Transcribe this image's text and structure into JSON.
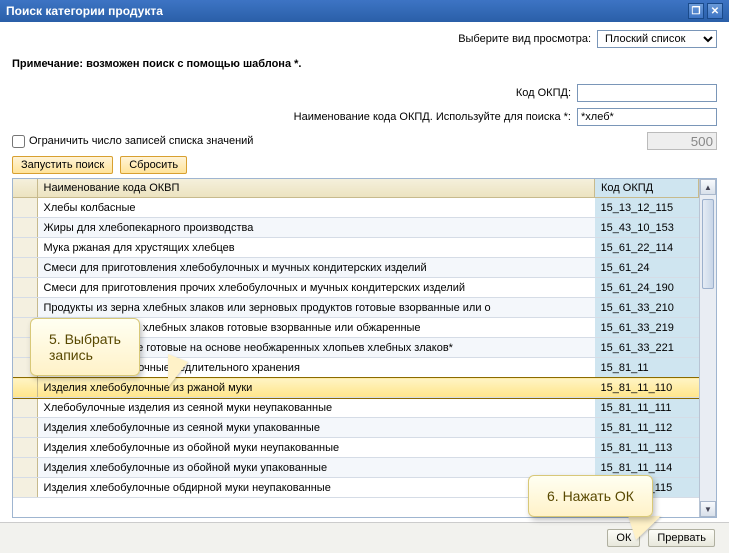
{
  "title": "Поиск категории продукта",
  "viewSelect": {
    "label": "Выберите вид просмотра:",
    "value": "Плоский список"
  },
  "note": "Примечание: возможен поиск с помощью шаблона *.",
  "form": {
    "codeLabel": "Код ОКПД:",
    "codeValue": "",
    "nameLabel": "Наименование кода ОКПД. Используйте для поиска *:",
    "nameValue": "*хлеб*"
  },
  "limit": {
    "label": "Ограничить число записей списка значений",
    "value": "500"
  },
  "buttons": {
    "search": "Запустить поиск",
    "reset": "Сбросить",
    "ok": "ОК",
    "cancel": "Прервать"
  },
  "columns": {
    "name": "Наименование кода ОКВП",
    "code": "Код ОКПД"
  },
  "rows": [
    {
      "name": "Хлебы колбасные",
      "code": "15_13_12_115"
    },
    {
      "name": "Жиры для хлебопекарного производства",
      "code": "15_43_10_153"
    },
    {
      "name": "Мука ржаная для хрустящих хлебцев",
      "code": "15_61_22_114"
    },
    {
      "name": "Смеси для приготовления хлебобулочных и мучных кондитерских изделий",
      "code": "15_61_24"
    },
    {
      "name": "Смеси для приготовления прочих хлебобулочных и мучных кондитерских изделий",
      "code": "15_61_24_190"
    },
    {
      "name": "Продукты из зерна хлебных злаков или зерновых продуктов готовые взорванные или о",
      "code": "15_61_33_210"
    },
    {
      "name": "Продукты из зерна хлебных злаков готовые взорванные или обжаренные",
      "code": "15_61_33_219"
    },
    {
      "name": "Продукты пищевые готовые на основе необжаренных хлопьев хлебных злаков*",
      "code": "15_61_33_221"
    },
    {
      "name": "Изделия хлебобулочные  недлительного хранения",
      "code": "15_81_11"
    },
    {
      "name": "Изделия хлебобулочные из ржаной муки",
      "code": "15_81_11_110",
      "selected": true
    },
    {
      "name": "Хлебобулочные изделия из сеяной муки неупакованные",
      "code": "15_81_11_111"
    },
    {
      "name": "Изделия хлебобулочные из сеяной муки упакованные",
      "code": "15_81_11_112"
    },
    {
      "name": "Изделия хлебобулочные из обойной муки неупакованные",
      "code": "15_81_11_113"
    },
    {
      "name": "Изделия хлебобулочные из обойной муки упакованные",
      "code": "15_81_11_114"
    },
    {
      "name": "Изделия хлебобулочные обдирной муки неупакованные",
      "code": "15_81_11_115"
    }
  ],
  "callouts": {
    "c1": "5. Выбрать\nзапись",
    "c2": "6. Нажать ОК"
  }
}
